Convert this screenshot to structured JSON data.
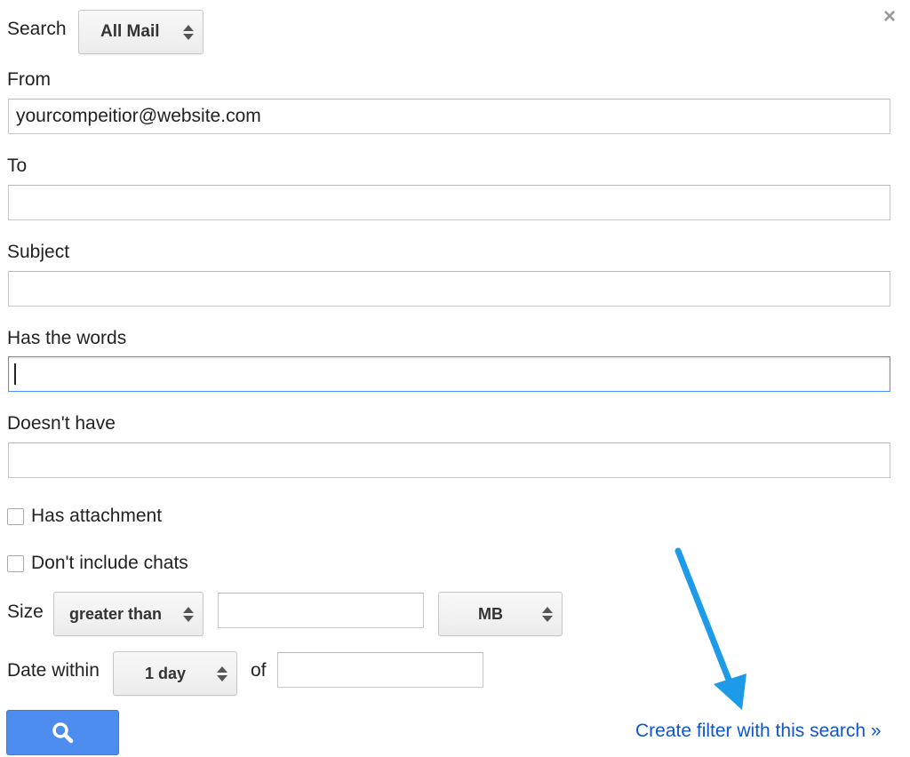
{
  "search": {
    "label": "Search",
    "scope_value": "All Mail"
  },
  "fields": {
    "from": {
      "label": "From",
      "value": "yourcompeitior@website.com"
    },
    "to": {
      "label": "To",
      "value": ""
    },
    "subject": {
      "label": "Subject",
      "value": ""
    },
    "has_words": {
      "label": "Has the words",
      "value": ""
    },
    "doesnt_have": {
      "label": "Doesn't have",
      "value": ""
    }
  },
  "checkboxes": {
    "has_attachment": {
      "label": "Has attachment",
      "checked": false
    },
    "dont_include_chats": {
      "label": "Don't include chats",
      "checked": false
    }
  },
  "size": {
    "label": "Size",
    "comparator_value": "greater than",
    "amount_value": "",
    "unit_value": "MB"
  },
  "date": {
    "label": "Date within",
    "range_value": "1 day",
    "of_label": "of",
    "of_value": ""
  },
  "actions": {
    "create_filter_label": "Create filter with this search »"
  },
  "icons": {
    "close": "close-icon",
    "search": "search-icon",
    "annotation_arrow": "arrow-icon"
  },
  "colors": {
    "search_button": "#4d8df0",
    "link": "#1155cc",
    "focus_border": "#4d90fe",
    "annotation_arrow": "#1e9be8"
  }
}
